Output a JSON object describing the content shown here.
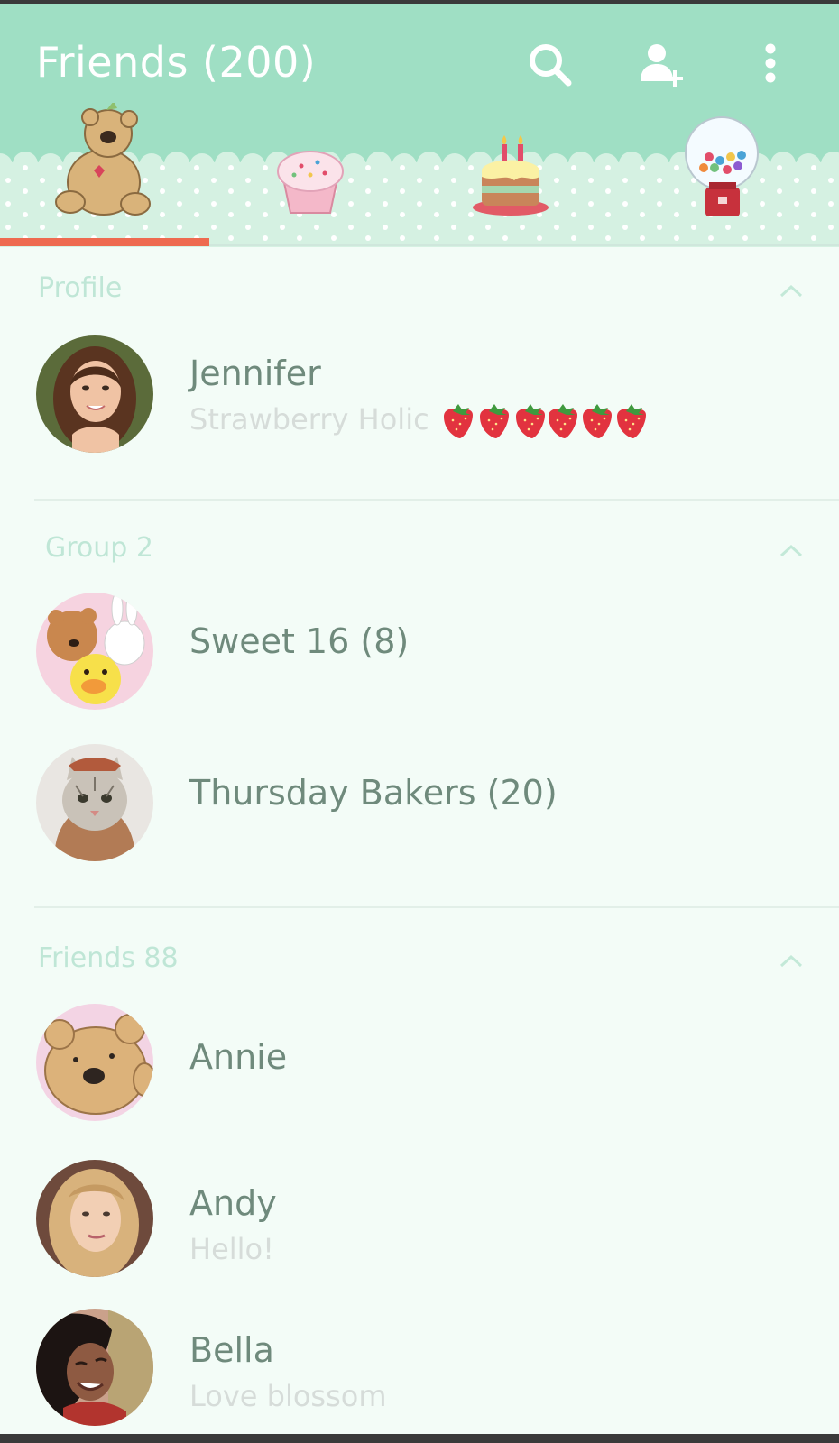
{
  "header": {
    "title": "Friends (200)",
    "icons": [
      "search-icon",
      "add-friend-icon",
      "more-vert-icon"
    ],
    "background": "#9fdfc4"
  },
  "tabs": {
    "items": [
      "teddy-bear-tab",
      "cupcake-tab",
      "birthday-cake-tab",
      "gumball-machine-tab"
    ],
    "selected_index": 0,
    "indicator_color": "#ee6a50"
  },
  "sections": {
    "profile": {
      "title": "Profile",
      "name": "Jennifer",
      "status": "Strawberry Holic",
      "status_emoji_count": 6
    },
    "groups": {
      "title": "Group 2",
      "items": [
        {
          "name": "Sweet 16 (8)"
        },
        {
          "name": "Thursday Bakers (20)"
        }
      ]
    },
    "friends": {
      "title": "Friends 88",
      "items": [
        {
          "name": "Annie",
          "status": ""
        },
        {
          "name": "Andy",
          "status": "Hello!"
        },
        {
          "name": "Bella",
          "status": "Love blossom"
        }
      ]
    }
  },
  "colors": {
    "accent": "#ee6a50",
    "section_title": "#bfe6d6",
    "name_text": "#6f8a7c",
    "status_text": "#d6dcd9",
    "background": "#f3fcf7"
  }
}
